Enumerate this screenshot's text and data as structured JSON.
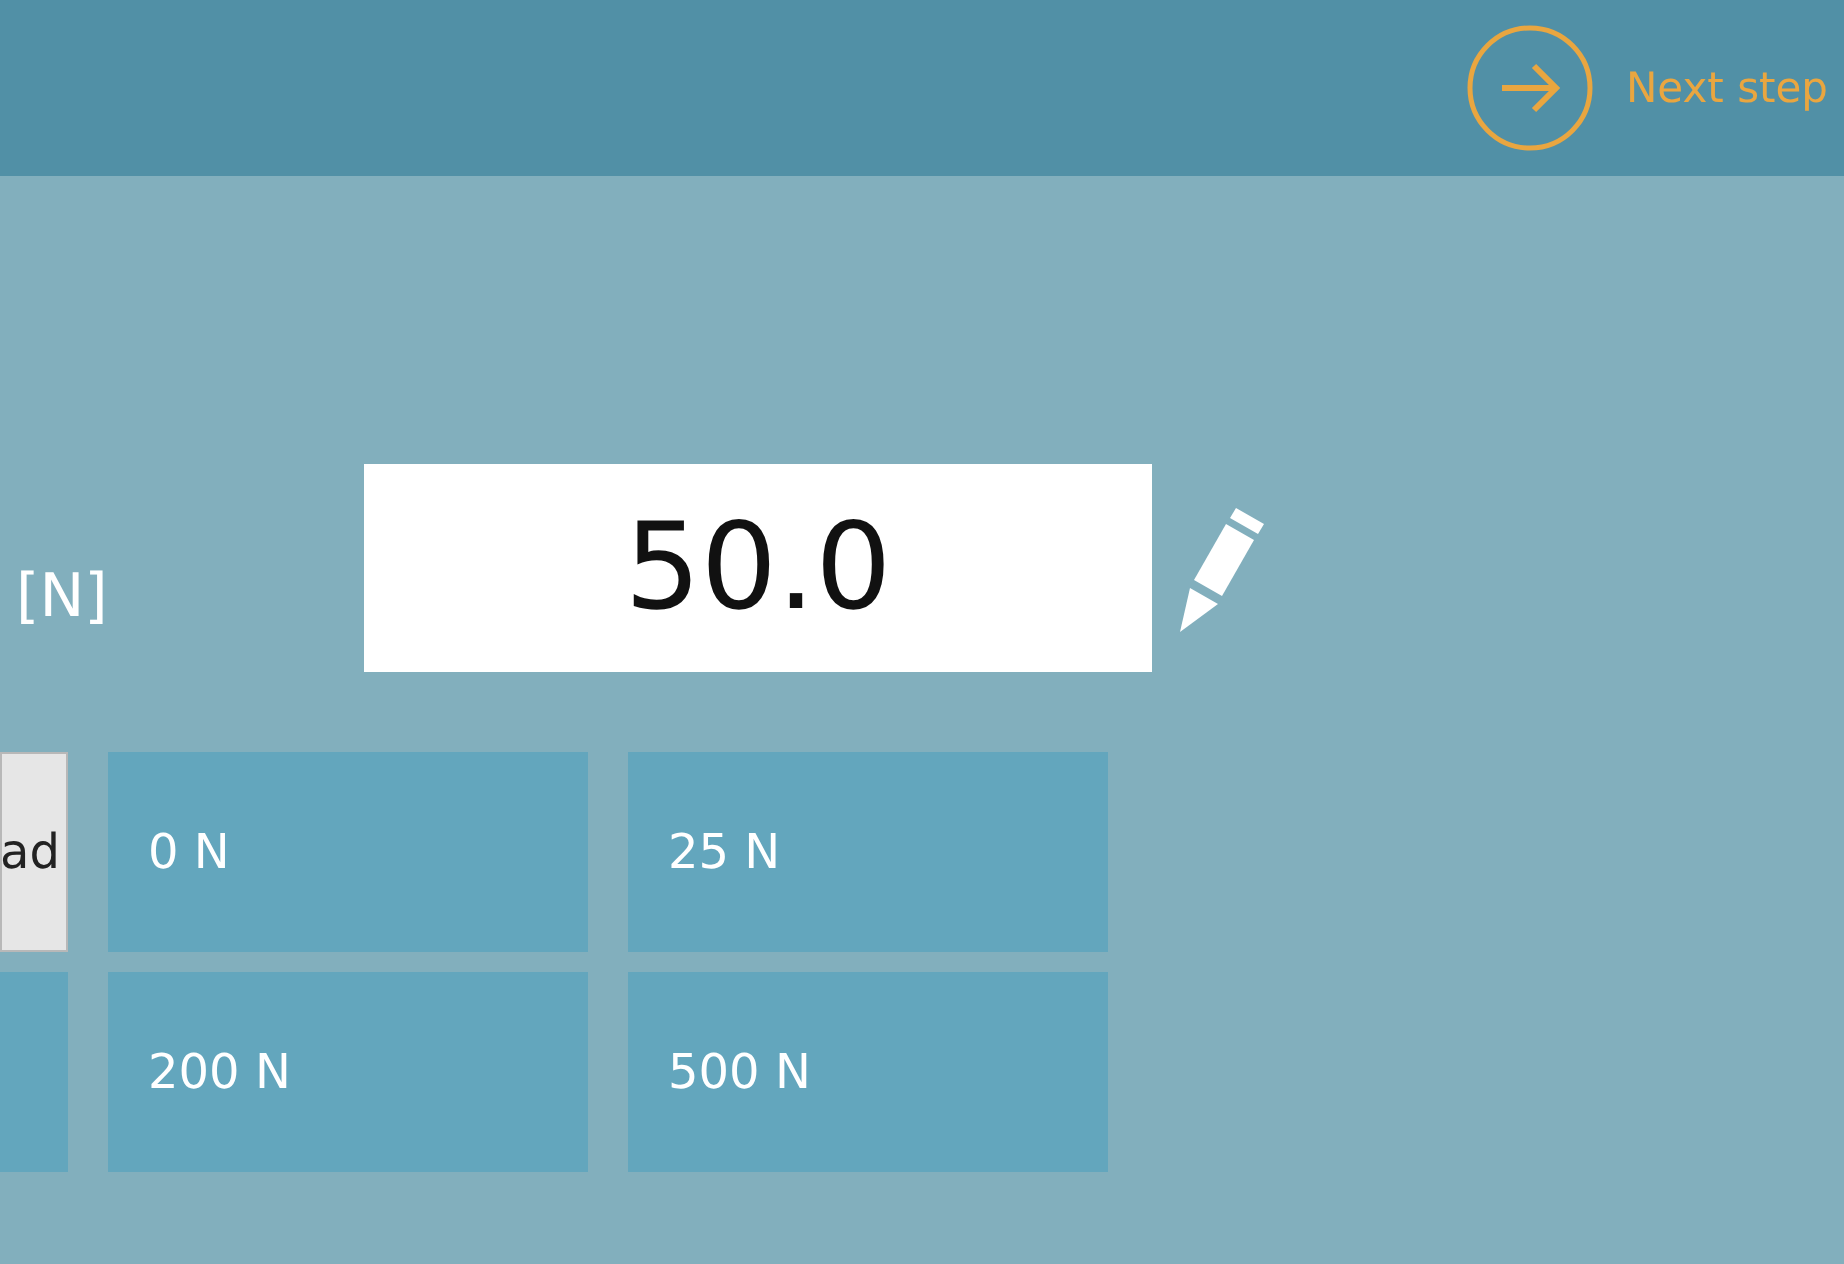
{
  "header": {
    "next_button": {
      "label": "Next step"
    }
  },
  "force": {
    "unit_label": "[N]",
    "value": "50.0"
  },
  "presets": [
    {
      "label": "ad",
      "selected": true
    },
    {
      "label": "0 N",
      "selected": false
    },
    {
      "label": "25 N",
      "selected": false
    },
    {
      "selected": false
    },
    {
      "label": "200 N",
      "selected": false
    },
    {
      "label": "500 N",
      "selected": false
    }
  ]
}
